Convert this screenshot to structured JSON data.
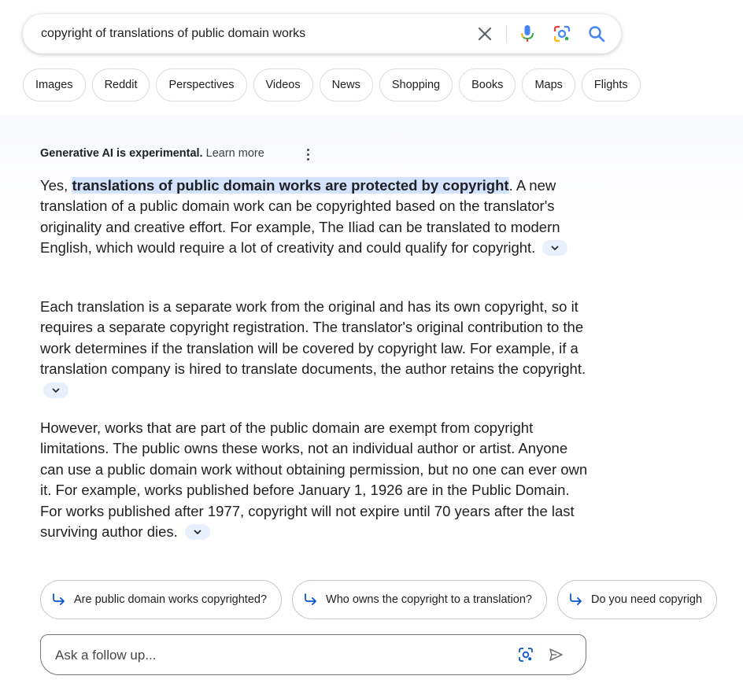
{
  "search": {
    "query": "copyright of translations of public domain works"
  },
  "icons": {
    "clear": "close-icon",
    "voice": "microphone-icon",
    "lens": "camera-lens-icon",
    "search": "search-icon"
  },
  "chips": [
    "Images",
    "Reddit",
    "Perspectives",
    "Videos",
    "News",
    "Shopping",
    "Books",
    "Maps",
    "Flights"
  ],
  "ai": {
    "experimental_label": "Generative AI is experimental.",
    "learn_more": "Learn more",
    "p1_prefix": "Yes, ",
    "p1_highlight": "translations of public domain works are protected by copyright",
    "p1_rest": ". A new translation of a public domain work can be copyrighted based on the translator's originality and creative effort. For example, The Iliad can be translated to modern English, which would require a lot of creativity and could qualify for copyright.",
    "p2": "Each translation is a separate work from the original and has its own copyright, so it requires a separate copyright registration. The translator's original contribution to the work determines if the translation will be covered by copyright law. For example, if a translation company is hired to translate documents, the author retains the copyright.",
    "p3": "However, works that are part of the public domain are exempt from copyright limitations. The public owns these works, not an individual author or artist. Anyone can use a public domain work without obtaining permission, but no one can ever own it. For example, works published before January 1, 1926 are in the Public Domain. For works published after 1977, copyright will not expire until 70 years after the last surviving author dies."
  },
  "followups": [
    "Are public domain works copyrighted?",
    "Who owns the copyright to a translation?",
    "Do you need copyrigh"
  ],
  "ask": {
    "placeholder": "Ask a follow up..."
  },
  "colors": {
    "highlight": "#d3e3fd",
    "search_blue": "#4285f4"
  }
}
